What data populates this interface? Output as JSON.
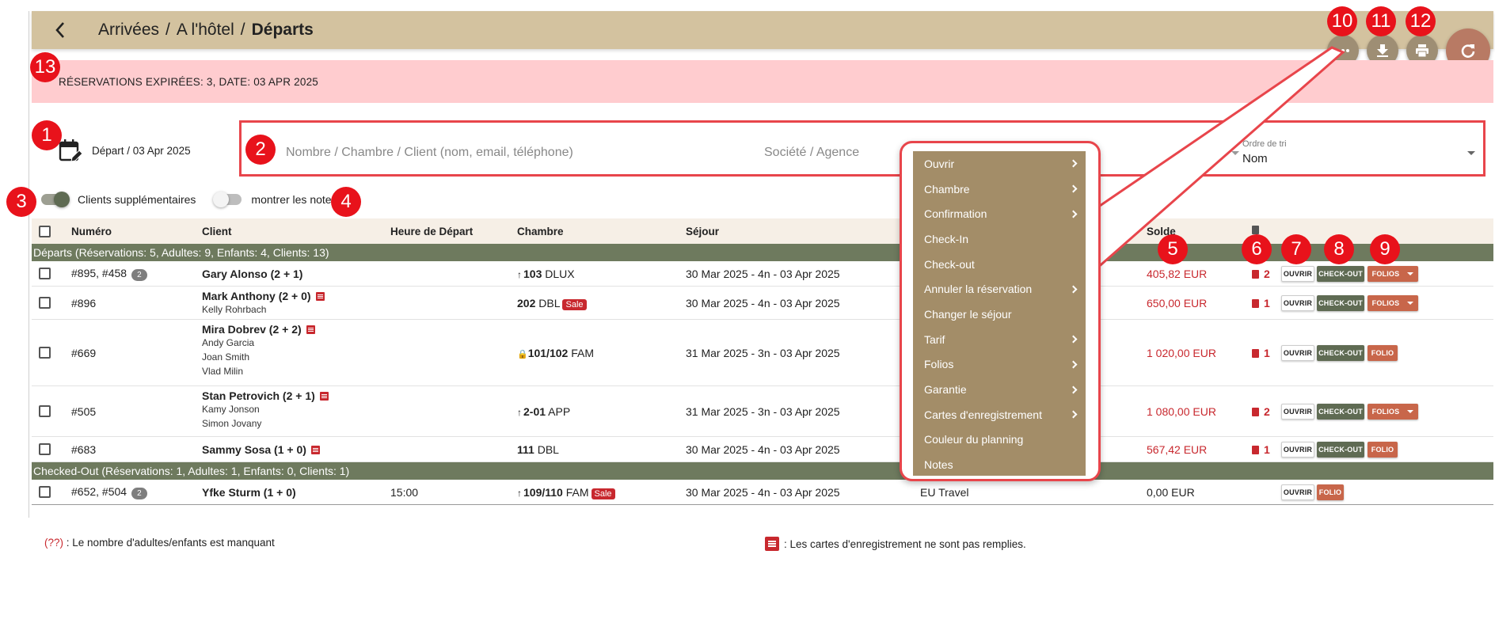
{
  "header": {
    "breadcrumb": [
      "Arrivées",
      "A l'hôtel",
      "Départs"
    ],
    "separators": [
      "/",
      "/"
    ]
  },
  "alert": {
    "text": "RÉSERVATIONS EXPIRÉES: 3, DATE: 03 APR 2025"
  },
  "date_label": "Départ / 03 Apr 2025",
  "search": {
    "placeholder": "Nombre / Chambre / Client (nom, email, téléphone)",
    "company_placeholder": "Société / Agence",
    "sort_label": "Ordre de tri",
    "sort_value": "Nom"
  },
  "toggles": {
    "extra_clients": {
      "label": "Clients supplémentaires",
      "on": true
    },
    "show_notes": {
      "label": "montrer les notes",
      "on": false
    }
  },
  "table": {
    "headers": {
      "number": "Numéro",
      "client": "Client",
      "departure_time": "Heure de Départ",
      "room": "Chambre",
      "stay": "Séjour",
      "balance": "Solde"
    },
    "groups": [
      {
        "label": "Départs (Réservations: 5, Adultes: 9, Enfants: 4, Clients: 13)"
      },
      {
        "label": "Checked-Out (Réservations: 1, Adultes: 1, Enfants: 0, Clients: 1)"
      }
    ],
    "rows": [
      {
        "number": "#895, #458",
        "count": "2",
        "client": "Gary Alonso (2 + 1)",
        "subs": [],
        "time": "",
        "room": "103",
        "room_type": "DLUX",
        "stay": "30 Mar 2025 - 4n - 03 Apr 2025",
        "company": "",
        "balance": "405,82 EUR",
        "docs": "2"
      },
      {
        "number": "#896",
        "client": "Mark Anthony (2 + 0)",
        "subs": [
          "Kelly Rohrbach"
        ],
        "time": "",
        "room": "202",
        "room_type": "DBL",
        "sale": "Sale",
        "stay": "30 Mar 2025 - 4n - 03 Apr 2025",
        "company": "",
        "balance": "650,00 EUR",
        "docs": "1"
      },
      {
        "number": "#669",
        "client": "Mira Dobrev (2 + 2)",
        "subs": [
          "Andy Garcia",
          "Joan Smith",
          "Vlad Milin"
        ],
        "time": "",
        "room": "101/102",
        "room_type": "FAM",
        "stay": "31 Mar 2025 - 3n - 03 Apr 2025",
        "company": "",
        "balance": "1 020,00 EUR",
        "docs": "1"
      },
      {
        "number": "#505",
        "client": "Stan Petrovich (2 + 1)",
        "subs": [
          "Kamy Jonson",
          "Simon Jovany"
        ],
        "time": "",
        "room": "2-01",
        "room_type": "APP",
        "stay": "31 Mar 2025 - 3n - 03 Apr 2025",
        "company": "",
        "balance": "1 080,00 EUR",
        "docs": "2"
      },
      {
        "number": "#683",
        "client": "Sammy Sosa (1 + 0)",
        "subs": [],
        "time": "",
        "room": "111",
        "room_type": "DBL",
        "stay": "30 Mar 2025 - 4n - 03 Apr 2025",
        "company": "",
        "balance": "567,42 EUR",
        "docs": "1"
      },
      {
        "number": "#652, #504",
        "count": "2",
        "client": "Yfke Sturm (1 + 0)",
        "subs": [],
        "time": "15:00",
        "room": "109/110",
        "room_type": "FAM",
        "sale": "Sale",
        "stay": "30 Mar 2025 - 4n - 03 Apr 2025",
        "company": "EU Travel",
        "balance": "0,00 EUR",
        "docs": ""
      }
    ],
    "buttons": {
      "open": "OUVRIR",
      "checkout": "CHECK-OUT",
      "folios": "FOLIOS",
      "folio": "FOLIO"
    }
  },
  "context_menu": [
    {
      "label": "Ouvrir",
      "submenu": true
    },
    {
      "label": "Chambre",
      "submenu": true
    },
    {
      "label": "Confirmation",
      "submenu": true
    },
    {
      "label": "Check-In",
      "submenu": false
    },
    {
      "label": "Check-out",
      "submenu": false
    },
    {
      "label": "Annuler la réservation",
      "submenu": true
    },
    {
      "label": "Changer le séjour",
      "submenu": false
    },
    {
      "label": "Tarif",
      "submenu": true
    },
    {
      "label": "Folios",
      "submenu": true
    },
    {
      "label": "Garantie",
      "submenu": true
    },
    {
      "label": "Cartes d'enregistrement",
      "submenu": true
    },
    {
      "label": "Couleur du planning",
      "submenu": false
    },
    {
      "label": "Notes",
      "submenu": false
    }
  ],
  "footer": {
    "missing_note_marker": "(??)",
    "missing_note": ": Le nombre d'adultes/enfants est manquant",
    "cards_note": ": Les cartes d'enregistrement ne sont pas remplies."
  },
  "annotations": [
    "1",
    "2",
    "3",
    "4",
    "5",
    "6",
    "7",
    "8",
    "9",
    "10",
    "11",
    "12",
    "13"
  ],
  "colors": {
    "header": "#d3c29f",
    "alert": "#ffcccf",
    "group_row": "#6e7a5e",
    "checkout_btn": "#5f6b53",
    "folio_btn": "#c8664a",
    "menu_bg": "#a38d68",
    "annotation": "#e8121b",
    "refresh_btn": "#b87a64"
  }
}
